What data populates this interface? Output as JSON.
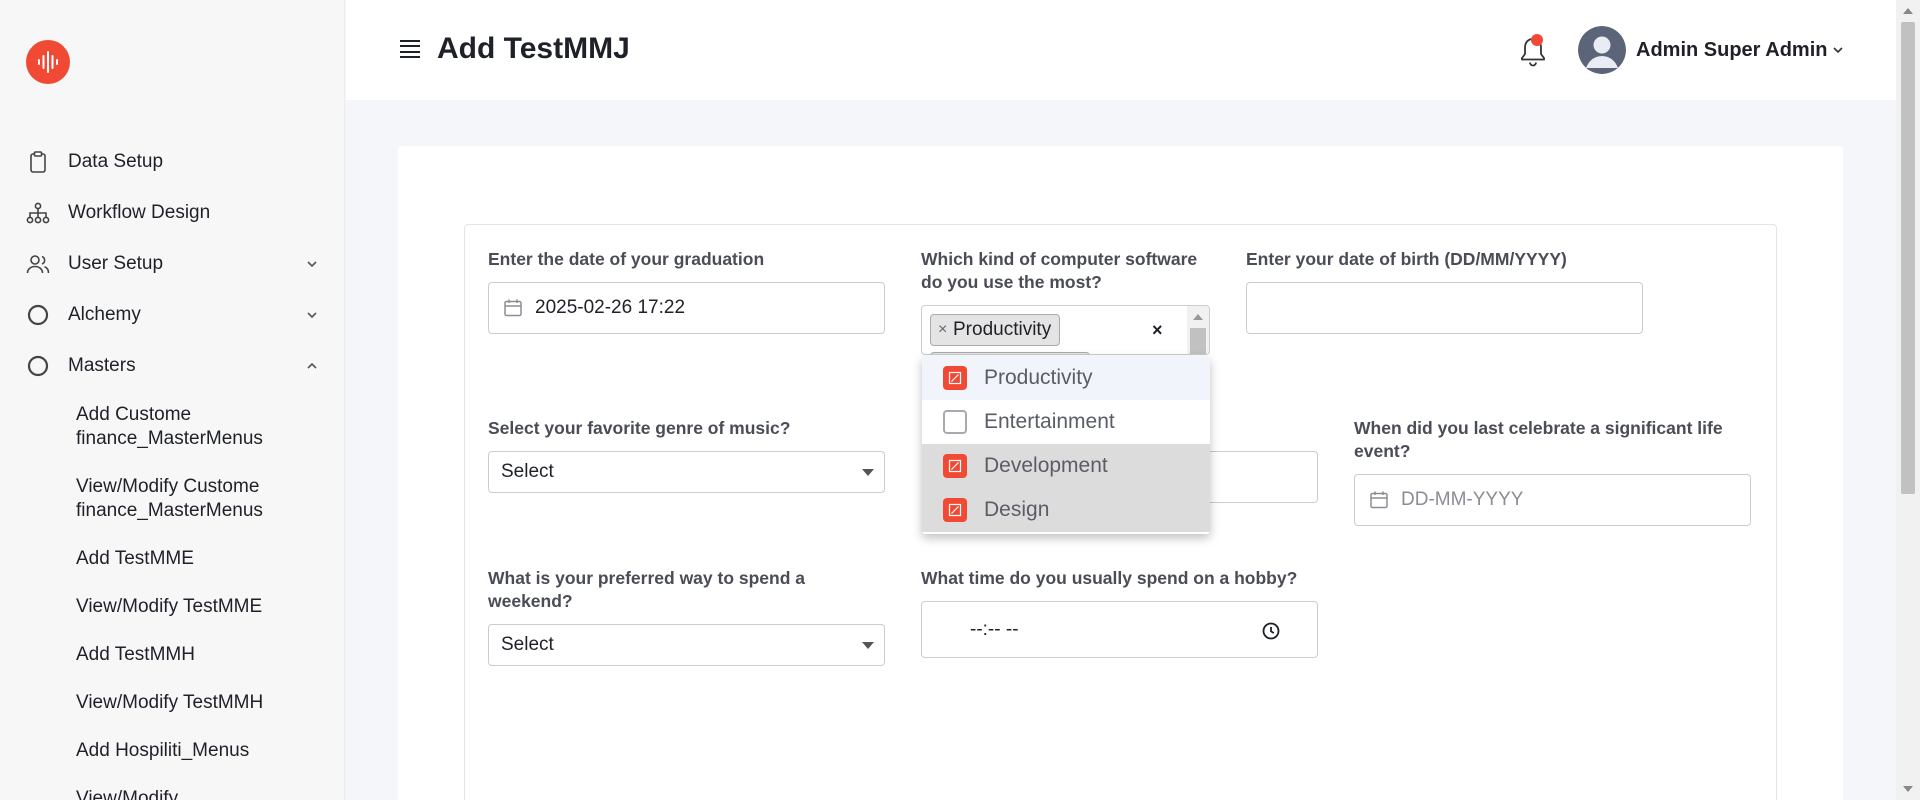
{
  "sidebar": {
    "items": [
      {
        "label": "Data Setup",
        "icon": "clipboard-icon"
      },
      {
        "label": "Workflow Design",
        "icon": "hierarchy-icon"
      },
      {
        "label": "User Setup",
        "icon": "users-icon",
        "chevron": "down"
      },
      {
        "label": "Alchemy",
        "icon": "circle-icon",
        "chevron": "down"
      },
      {
        "label": "Masters",
        "icon": "circle-icon",
        "chevron": "up"
      }
    ],
    "sub_items": [
      "Add Custome finance_MasterMenus",
      "View/Modify Custome finance_MasterMenus",
      "Add TestMME",
      "View/Modify TestMME",
      "Add TestMMH",
      "View/Modify TestMMH",
      "Add Hospiliti_Menus",
      "View/Modify"
    ]
  },
  "header": {
    "title": "Add TestMMJ",
    "user_name": "Admin Super Admin",
    "notification_icon": "bell-icon"
  },
  "form": {
    "graduation_label": "Enter the date of your graduation",
    "graduation_value": "2025-02-26 17:22",
    "software_label": "Which kind of computer software do you use the most?",
    "software_selected_tag": "Productivity",
    "dob_label": "Enter your date of birth (DD/MM/YYYY)",
    "dob_value": "",
    "music_label": "Select your favorite genre of music?",
    "music_value": "Select",
    "life_event_label": "When did you last celebrate a significant life event?",
    "life_event_placeholder": "DD-MM-YYYY",
    "weekend_label": "What is your preferred way to spend a weekend?",
    "weekend_value": "Select",
    "hobby_time_label": "What time do you usually spend on a hobby?",
    "hobby_time_value": "--:-- --"
  },
  "software_options": [
    {
      "label": "Productivity",
      "checked": true
    },
    {
      "label": "Entertainment",
      "checked": false
    },
    {
      "label": "Development",
      "checked": true
    },
    {
      "label": "Design",
      "checked": true
    }
  ],
  "colors": {
    "accent": "#f04a34",
    "sidebar_bg": "#f7f7f8",
    "page_bg": "#f4f6fa"
  }
}
